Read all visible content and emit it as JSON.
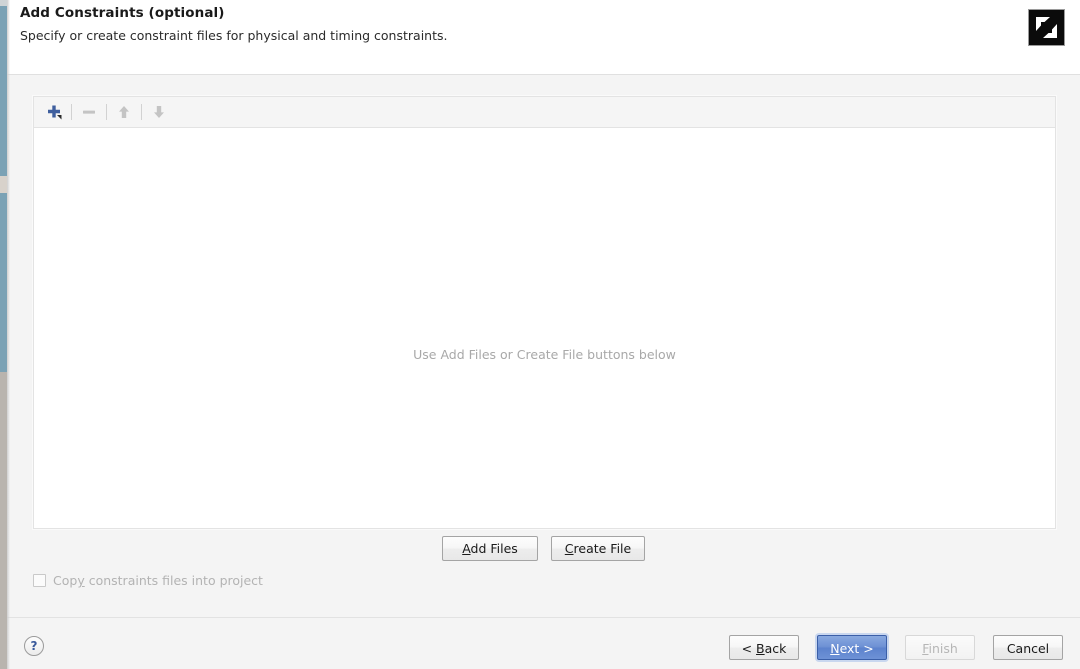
{
  "header": {
    "title": "Add Constraints (optional)",
    "subtitle": "Specify or create constraint files for physical and timing constraints.",
    "logo_icon": "amd-logo-icon"
  },
  "toolbar": {
    "add_icon": "plus-with-dropdown-icon",
    "remove_icon": "minus-icon",
    "move_up_icon": "arrow-up-icon",
    "move_down_icon": "arrow-down-icon"
  },
  "list": {
    "empty_message": "Use Add Files or Create File buttons below"
  },
  "file_buttons": {
    "add_files": {
      "prefix": "",
      "mnemonic": "A",
      "suffix": "dd Files"
    },
    "create_file": {
      "prefix": "",
      "mnemonic": "C",
      "suffix": "reate File"
    }
  },
  "options": {
    "copy_constraints": {
      "label_before": "Cop",
      "mnemonic": "y",
      "label_after": " constraints files into project",
      "checked": false,
      "enabled": false
    }
  },
  "footer": {
    "help_icon": "question-mark-icon",
    "help_glyph": "?",
    "back": {
      "prefix": "< ",
      "mnemonic": "B",
      "suffix": "ack"
    },
    "next": {
      "prefix": "",
      "mnemonic": "N",
      "suffix": "ext >"
    },
    "finish": {
      "prefix": "",
      "mnemonic": "F",
      "suffix": "inish"
    },
    "cancel": {
      "label": "Cancel"
    }
  },
  "colors": {
    "primary_button": "#6d90d4",
    "accent_blue": "#3a5a9b",
    "panel_background": "#ffffff",
    "dialog_background": "#f4f4f4",
    "disabled_text": "#b3b3b3",
    "placeholder_text": "#a8a8a8",
    "left_strip": "#7ba2b5"
  }
}
